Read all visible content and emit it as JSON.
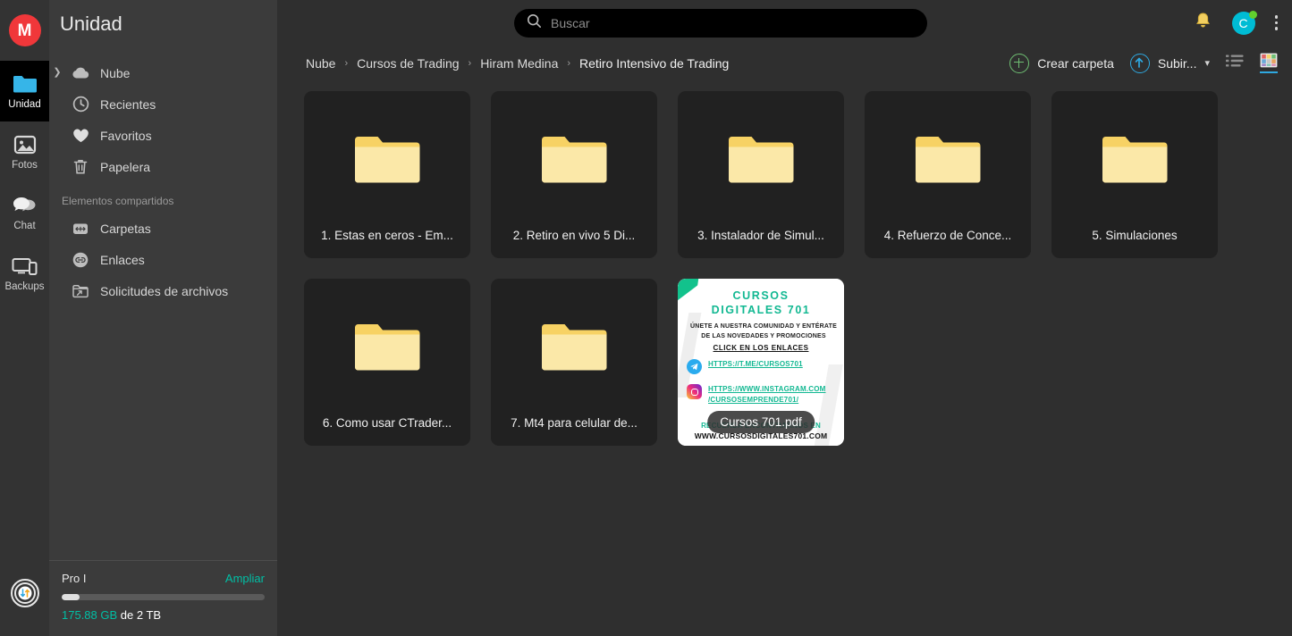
{
  "rail": {
    "logo_letter": "M",
    "items": [
      {
        "label": "Unidad",
        "icon": "folder-icon",
        "active": true
      },
      {
        "label": "Fotos",
        "icon": "photos-icon",
        "active": false
      },
      {
        "label": "Chat",
        "icon": "chat-icon",
        "active": false
      },
      {
        "label": "Backups",
        "icon": "backups-icon",
        "active": false
      }
    ],
    "transfers_icon": "transfers-icon"
  },
  "sidebar": {
    "title": "Unidad",
    "items": [
      {
        "label": "Nube",
        "icon": "cloud-icon",
        "expandable": true
      },
      {
        "label": "Recientes",
        "icon": "clock-icon",
        "expandable": false
      },
      {
        "label": "Favoritos",
        "icon": "heart-icon",
        "expandable": false
      },
      {
        "label": "Papelera",
        "icon": "trash-icon",
        "expandable": false
      }
    ],
    "shared_section_label": "Elementos compartidos",
    "shared_items": [
      {
        "label": "Carpetas",
        "icon": "shared-folders-icon"
      },
      {
        "label": "Enlaces",
        "icon": "link-icon"
      },
      {
        "label": "Solicitudes de archivos",
        "icon": "file-request-icon"
      }
    ],
    "storage": {
      "plan": "Pro I",
      "upgrade_label": "Ampliar",
      "used": "175.88 GB",
      "total_suffix": " de 2 TB",
      "percent": 9,
      "accent": "#00bfa5"
    }
  },
  "topbar": {
    "search_placeholder": "Buscar",
    "search_value": "",
    "search_icon": "search-icon",
    "bell_icon": "bell-icon",
    "avatar_letter": "C",
    "avatar_color": "#00bcd4",
    "status_color": "#62d02e",
    "menu_icon": "kebab-menu-icon"
  },
  "breadcrumb": {
    "items": [
      "Nube",
      "Cursos de Trading",
      "Hiram Medina",
      "Retiro Intensivo de Trading"
    ],
    "separator": "›"
  },
  "actions": {
    "create_folder": "Crear carpeta",
    "upload": "Subir...",
    "upload_caret": "⌄",
    "list_view_icon": "list-view-icon",
    "grid_view_icon": "grid-view-icon",
    "active_view": "grid"
  },
  "files": {
    "row1": [
      {
        "name": "1. Estas en ceros - Em...",
        "type": "folder",
        "icon": "folder-icon"
      },
      {
        "name": "2. Retiro en vivo 5 Di...",
        "type": "folder",
        "icon": "folder-icon"
      },
      {
        "name": "3. Instalador de Simul...",
        "type": "folder",
        "icon": "folder-icon"
      },
      {
        "name": "4. Refuerzo de Conce...",
        "type": "folder",
        "icon": "folder-icon"
      },
      {
        "name": "5. Simulaciones",
        "type": "folder",
        "icon": "folder-icon"
      }
    ],
    "row2": [
      {
        "name": "6. Como usar CTrader...",
        "type": "folder",
        "icon": "folder-icon"
      },
      {
        "name": "7. Mt4 para celular de...",
        "type": "folder",
        "icon": "folder-icon"
      },
      {
        "name": "Cursos 701.pdf",
        "type": "pdf",
        "icon": "pdf-thumbnail"
      }
    ]
  },
  "pdf_preview": {
    "title_line1": "CURSOS",
    "title_line2": "DIGITALES 701",
    "subtitle_line1": "ÚNETE A NUESTRA COMUNIDAD Y ENTÉRATE",
    "subtitle_line2": "DE LAS NOVEDADES Y PROMOCIONES",
    "cta": "CLICK EN LOS ENLACES",
    "telegram_link": "HTTPS://T.ME/CURSOS701",
    "instagram_link_line1": "HTTPS://WWW.INSTAGRAM.COM",
    "instagram_link_line2": "/CURSOSEMPRENDE701/",
    "footer_line1": "RECUERDA ENCONTRARNOS EN",
    "footer_line2": "WWW.CURSOSDIGITALES701.COM",
    "brand_color": "#12b892",
    "telegram_icon": "telegram-icon",
    "instagram_icon": "instagram-icon",
    "filename_overlay": "Cursos 701.pdf"
  }
}
